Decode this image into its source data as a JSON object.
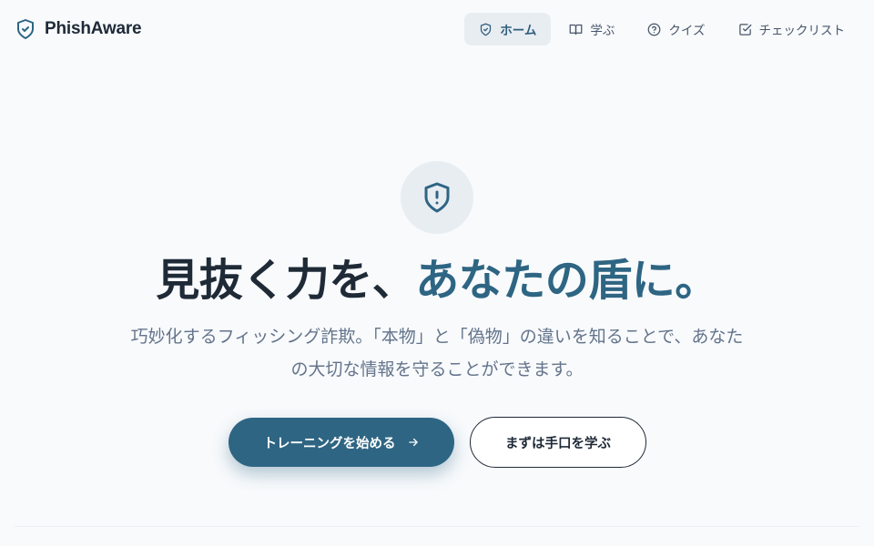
{
  "header": {
    "brand_name": "PhishAware",
    "brand_icon": "shield-check-icon",
    "nav": [
      {
        "label": "ホーム",
        "icon": "shield-check-icon",
        "active": true
      },
      {
        "label": "学ぶ",
        "icon": "book-open-icon",
        "active": false
      },
      {
        "label": "クイズ",
        "icon": "help-circle-icon",
        "active": false
      },
      {
        "label": "チェックリスト",
        "icon": "check-square-icon",
        "active": false
      }
    ]
  },
  "hero": {
    "icon": "shield-alert-icon",
    "headline_main": "見抜く力を、",
    "headline_accent": "あなたの盾に。",
    "subtitle": "巧妙化するフィッシング詐欺。「本物」と「偽物」の違いを知ることで、あなたの大切な情報を守ることができます。",
    "primary_button": "トレーニングを始める",
    "primary_button_icon": "arrow-right-icon",
    "secondary_button": "まずは手口を学ぶ"
  },
  "colors": {
    "background": "#f8fafc",
    "accent": "#2e6583",
    "text": "#1f2a37",
    "muted": "#64748b",
    "nav_active_bg": "#e8edf2"
  }
}
